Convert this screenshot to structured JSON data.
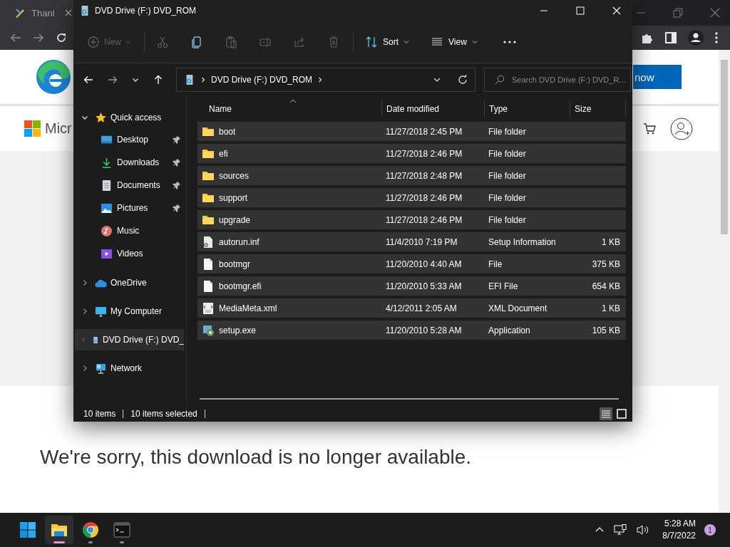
{
  "browser": {
    "tab_title": "Thanl",
    "page": {
      "brand_text": "Micr",
      "action_button": "now",
      "message": "We're sorry, this download is no longer available."
    }
  },
  "explorer": {
    "title": "DVD Drive (F:) DVD_ROM",
    "commands": [
      {
        "kind": "new",
        "label": "New",
        "disabled": true
      },
      {
        "kind": "cut",
        "disabled": true
      },
      {
        "kind": "copy",
        "disabled": false
      },
      {
        "kind": "paste",
        "disabled": true
      },
      {
        "kind": "rename",
        "disabled": true
      },
      {
        "kind": "share",
        "disabled": true
      },
      {
        "kind": "delete",
        "disabled": true
      }
    ],
    "sort_label": "Sort",
    "view_label": "View",
    "address": {
      "path": "DVD Drive (F:) DVD_ROM"
    },
    "search": {
      "placeholder": "Search DVD Drive (F:) DVD_R..."
    },
    "sidebar": [
      {
        "kind": "star",
        "label": "Quick access",
        "expanded": true,
        "selected": false,
        "children": [
          {
            "kind": "desktop",
            "label": "Desktop",
            "pinned": true,
            "selected": false
          },
          {
            "kind": "download",
            "label": "Downloads",
            "pinned": true,
            "selected": false
          },
          {
            "kind": "document",
            "label": "Documents",
            "pinned": true,
            "selected": false
          },
          {
            "kind": "pictures",
            "label": "Pictures",
            "pinned": true,
            "selected": false
          },
          {
            "kind": "music",
            "label": "Music",
            "pinned": false,
            "selected": false
          },
          {
            "kind": "videos",
            "label": "Videos",
            "pinned": false,
            "selected": false
          }
        ]
      },
      {
        "kind": "cloud",
        "label": "OneDrive",
        "expanded": false,
        "selected": false
      },
      {
        "kind": "computer",
        "label": "My Computer",
        "expanded": false,
        "selected": false
      },
      {
        "kind": "dvd",
        "label": "DVD Drive (F:) DVD_",
        "expanded": false,
        "selected": true
      },
      {
        "kind": "network",
        "label": "Network",
        "expanded": false,
        "selected": false
      }
    ],
    "columns": [
      {
        "label": "Name",
        "sorted": true
      },
      {
        "label": "Date modified",
        "sorted": false
      },
      {
        "label": "Type",
        "sorted": false
      },
      {
        "label": "Size",
        "sorted": false
      }
    ],
    "rows": [
      {
        "kind": "folder",
        "name": "boot",
        "date": "11/27/2018 2:45 PM",
        "type": "File folder",
        "selected": true
      },
      {
        "kind": "folder",
        "name": "efi",
        "date": "11/27/2018 2:46 PM",
        "type": "File folder",
        "selected": true
      },
      {
        "kind": "folder",
        "name": "sources",
        "date": "11/27/2018 2:48 PM",
        "type": "File folder",
        "selected": true
      },
      {
        "kind": "folder",
        "name": "support",
        "date": "11/27/2018 2:46 PM",
        "type": "File folder",
        "selected": true
      },
      {
        "kind": "folder",
        "name": "upgrade",
        "date": "11/27/2018 2:46 PM",
        "type": "File folder",
        "selected": true
      },
      {
        "kind": "settings",
        "name": "autorun.inf",
        "date": "11/4/2010 7:19 PM",
        "type": "Setup Information",
        "size": "1 KB",
        "selected": true
      },
      {
        "kind": "file",
        "name": "bootmgr",
        "date": "11/20/2010 4:40 AM",
        "type": "File",
        "size": "375 KB",
        "selected": true
      },
      {
        "kind": "file",
        "name": "bootmgr.efi",
        "date": "11/20/2010 5:33 AM",
        "type": "EFI File",
        "size": "654 KB",
        "selected": true
      },
      {
        "kind": "xml",
        "name": "MediaMeta.xml",
        "date": "4/12/2011 2:05 AM",
        "type": "XML Document",
        "size": "1 KB",
        "selected": true
      },
      {
        "kind": "app",
        "name": "setup.exe",
        "date": "11/20/2010 5:28 AM",
        "type": "Application",
        "size": "105 KB",
        "selected": true
      }
    ],
    "status": {
      "count": "10 items",
      "selection": "10 items selected"
    },
    "views": [
      {
        "kind": "details",
        "selected": true
      },
      {
        "kind": "tiles",
        "selected": false
      }
    ]
  },
  "taskbar": {
    "apps": [
      {
        "kind": "start",
        "selected": false
      },
      {
        "kind": "explorer",
        "selected": true
      },
      {
        "kind": "chrome",
        "selected": false
      },
      {
        "kind": "terminal",
        "selected": false
      }
    ],
    "time": "5:28 AM",
    "date": "8/7/2022",
    "notifications": "1"
  }
}
